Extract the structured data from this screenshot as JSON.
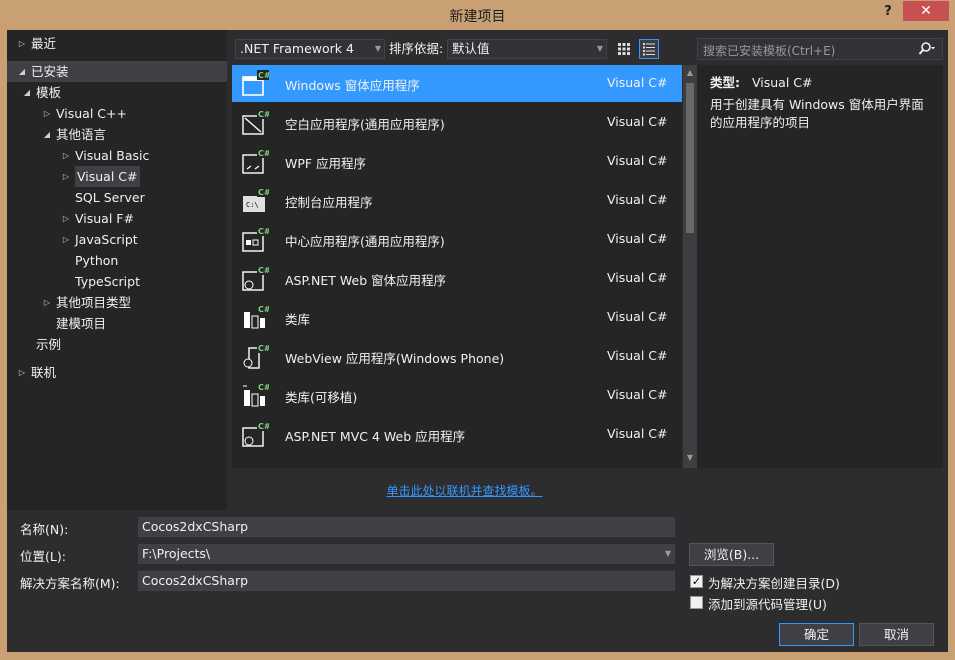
{
  "window": {
    "title": "新建项目",
    "help": "?",
    "close": "✕"
  },
  "tree": [
    {
      "label": "最近",
      "indent": 0,
      "expander": "right",
      "selected": false
    },
    {
      "label": "已安装",
      "indent": 0,
      "expander": "down",
      "selected": true
    },
    {
      "label": "模板",
      "indent": 1,
      "expander": "down",
      "selected": false
    },
    {
      "label": "Visual C++",
      "indent": 2,
      "expander": "right",
      "selected": false
    },
    {
      "label": "其他语言",
      "indent": 2,
      "expander": "down",
      "selected": false
    },
    {
      "label": "Visual Basic",
      "indent": 3,
      "expander": "right",
      "selected": false
    },
    {
      "label": "Visual C#",
      "indent": 3,
      "expander": "right",
      "selected": true
    },
    {
      "label": "SQL Server",
      "indent": 3,
      "expander": "",
      "selected": false
    },
    {
      "label": "Visual F#",
      "indent": 3,
      "expander": "right",
      "selected": false
    },
    {
      "label": "JavaScript",
      "indent": 3,
      "expander": "right",
      "selected": false
    },
    {
      "label": "Python",
      "indent": 3,
      "expander": "",
      "selected": false
    },
    {
      "label": "TypeScript",
      "indent": 3,
      "expander": "",
      "selected": false
    },
    {
      "label": "其他项目类型",
      "indent": 2,
      "expander": "right",
      "selected": false
    },
    {
      "label": "建模项目",
      "indent": 2,
      "expander": "",
      "selected": false
    },
    {
      "label": "示例",
      "indent": 1,
      "expander": "",
      "selected": false
    },
    {
      "label": "联机",
      "indent": 0,
      "expander": "right",
      "selected": false
    }
  ],
  "toolbar": {
    "framework": ".NET Framework 4",
    "sort_label": "排序依据:",
    "sort_value": "默认值"
  },
  "templates": [
    {
      "name": "Windows 窗体应用程序",
      "lang": "Visual C#",
      "icon": "windows-forms-icon",
      "selected": true
    },
    {
      "name": "空白应用程序(通用应用程序)",
      "lang": "Visual C#",
      "icon": "blank-app-icon",
      "selected": false
    },
    {
      "name": "WPF 应用程序",
      "lang": "Visual C#",
      "icon": "wpf-app-icon",
      "selected": false
    },
    {
      "name": "控制台应用程序",
      "lang": "Visual C#",
      "icon": "console-app-icon",
      "selected": false
    },
    {
      "name": "中心应用程序(通用应用程序)",
      "lang": "Visual C#",
      "icon": "hub-app-icon",
      "selected": false
    },
    {
      "name": "ASP.NET Web 窗体应用程序",
      "lang": "Visual C#",
      "icon": "aspnet-web-forms-icon",
      "selected": false
    },
    {
      "name": "类库",
      "lang": "Visual C#",
      "icon": "class-library-icon",
      "selected": false
    },
    {
      "name": "WebView 应用程序(Windows Phone)",
      "lang": "Visual C#",
      "icon": "webview-app-icon",
      "selected": false
    },
    {
      "name": "类库(可移植)",
      "lang": "Visual C#",
      "icon": "portable-library-icon",
      "selected": false
    },
    {
      "name": "ASP.NET MVC 4 Web 应用程序",
      "lang": "Visual C#",
      "icon": "aspnet-mvc-icon",
      "selected": false
    }
  ],
  "online_link": "单击此处以联机并查找模板。",
  "search": {
    "placeholder": "搜索已安装模板(Ctrl+E)"
  },
  "description": {
    "type_label": "类型:",
    "type_value": "Visual C#",
    "text": "用于创建具有 Windows 窗体用户界面的应用程序的项目"
  },
  "form": {
    "name_label": "名称(N):",
    "name_value": "Cocos2dxCSharp",
    "location_label": "位置(L):",
    "location_value": "F:\\Projects\\",
    "solution_label": "解决方案名称(M):",
    "solution_value": "Cocos2dxCSharp",
    "browse": "浏览(B)...",
    "create_dir_label": "为解决方案创建目录(D)",
    "create_dir_checked": true,
    "source_control_label": "添加到源代码管理(U)",
    "source_control_checked": false,
    "ok": "确定",
    "cancel": "取消"
  },
  "colors": {
    "accent": "#3399ff",
    "background": "#2d2d30",
    "panel": "#252526",
    "frame": "#c8a074"
  }
}
